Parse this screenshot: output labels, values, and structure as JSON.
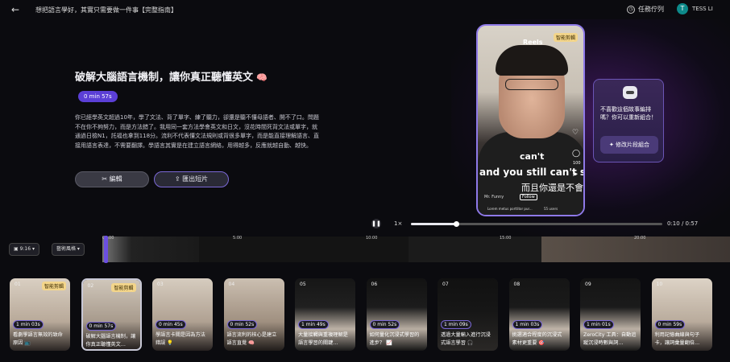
{
  "topbar": {
    "title": "想把語言學好，其實只需要做一件事【完整指南】",
    "queue": "任務佇列",
    "user_initial": "T",
    "user_name": "TESS LI"
  },
  "detail": {
    "heading": "破解大腦語言機制，讓你真正聽懂英文",
    "emoji": "🧠",
    "duration": "0 min 57s",
    "description": "你已經學英文超過10年，學了文法、背了單字、練了聽力，卻還是聽不懂母語者、開不了口。問題不在你不夠努力，而是方法錯了。我用同一套方法學會英文和日文，沒花時間死背文法或單字，就通過日檢N1，託福也拿到118分。流利不代表懂文法規則或背很多單字，而是能直接理解語言、直接用語言表達，不需要翻譯。學語言其實是在建立語言網絡，用得越多，反應就越自動、越快。",
    "edit_label": "編輯",
    "export_label": "匯出短片"
  },
  "preview": {
    "reels_label": "Reels",
    "smart_badge": "智能剪輯",
    "caption_line1": "can't",
    "caption_line2": "and you still can't spe",
    "caption_line3": "而且你還是不會",
    "side_count": "100",
    "username": "Mr. Funny",
    "follow_label": "Follow",
    "lorem": "Lorem metus porttitor pur...",
    "users": "55 users"
  },
  "suggest": {
    "text": "不喜歡這個故事編排嗎？你可以重新組合！",
    "button": "修改片段組合"
  },
  "player": {
    "speed": "1×",
    "time": "0:10 / 0:57",
    "progress_fraction": 0.18
  },
  "controls": {
    "ratio": "9:16",
    "style": "藝術風格"
  },
  "timeline": {
    "marks": [
      "00:00",
      "5:00",
      "10:00",
      "15:00",
      "20:00"
    ]
  },
  "clips": [
    {
      "num": "01",
      "duration": "1 min 03s",
      "caption": "看劇學語言無效的致命原因 📺",
      "tag": "智能剪輯"
    },
    {
      "num": "02",
      "duration": "0 min 57s",
      "caption": "破解大腦語言機制，讓你真正聽懂英文…",
      "tag": "智能剪輯"
    },
    {
      "num": "03",
      "duration": "0 min 45s",
      "caption": "學語言卡關是因為方法錯誤 💡",
      "tag": ""
    },
    {
      "num": "04",
      "duration": "0 min 52s",
      "caption": "語言流利的核心是建立語言直覺 🧠",
      "tag": ""
    },
    {
      "num": "05",
      "duration": "1 min 49s",
      "caption": "大量接觸與重複理解是語言學習的關鍵…",
      "tag": ""
    },
    {
      "num": "06",
      "duration": "0 min 52s",
      "caption": "如何量化沉浸式學習的進步？ 📈",
      "tag": ""
    },
    {
      "num": "07",
      "duration": "1 min 09s",
      "caption": "透過大量輸入進行沉浸式語言學習 🎧",
      "tag": ""
    },
    {
      "num": "08",
      "duration": "1 min 03s",
      "caption": "挑選適合程度的沉浸式素材更重要 🎯",
      "tag": ""
    },
    {
      "num": "09",
      "duration": "1 min 01s",
      "caption": "ZeroCity 工具：自動追蹤沉浸時數與詞…",
      "tag": ""
    },
    {
      "num": "10",
      "duration": "0 min 59s",
      "caption": "利用記憶曲線與句子卡，讓詞彙量翻倍…",
      "tag": ""
    }
  ],
  "colors": {
    "accent": "#5b3fd6",
    "badge": "#f3d58a"
  }
}
